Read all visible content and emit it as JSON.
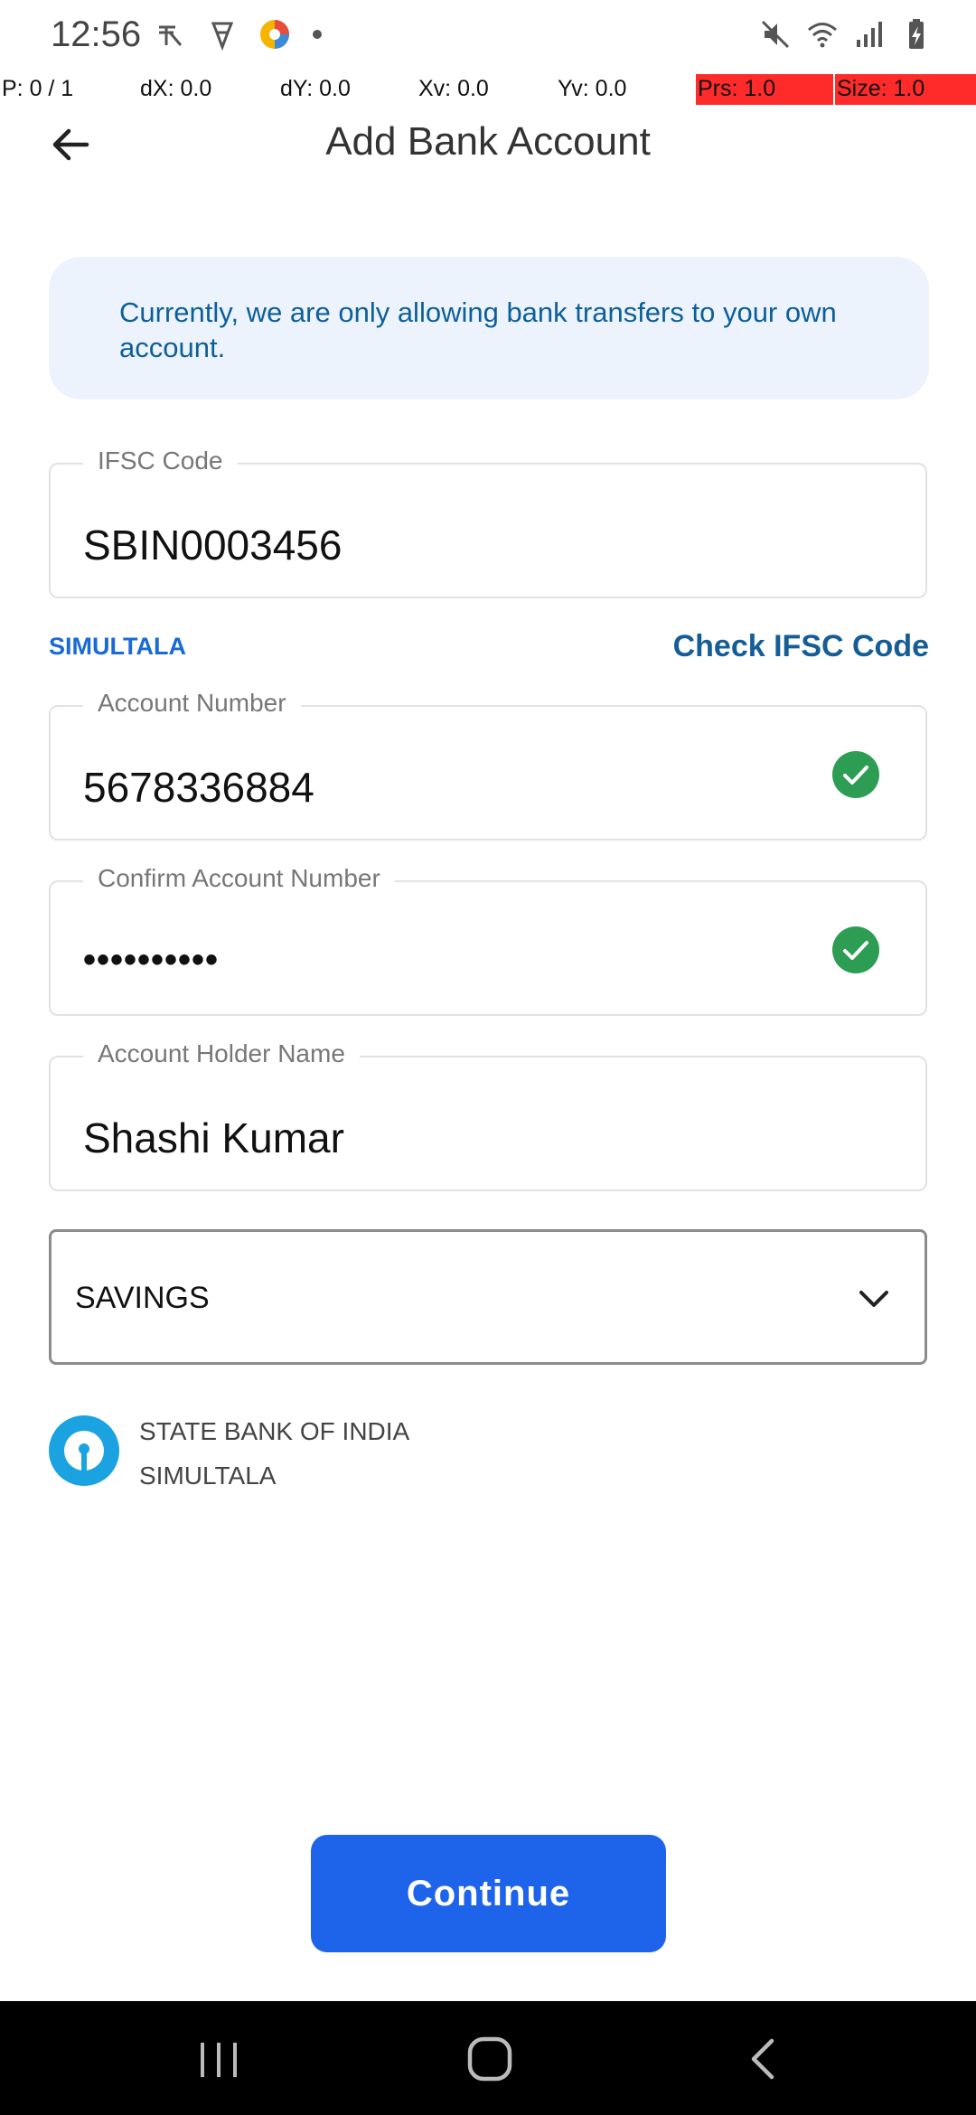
{
  "status_bar": {
    "time": "12:56",
    "left_icons": [
      "r-app-icon",
      "app-notification-icon",
      "colorful-app-icon",
      "dot-icon"
    ],
    "right_icons": [
      "mute-icon",
      "wifi-icon",
      "signal-icon",
      "battery-charging-icon"
    ]
  },
  "debug": {
    "p": "P: 0 / 1",
    "dx": "dX: 0.0",
    "dy": "dY: 0.0",
    "xv": "Xv: 0.0",
    "yv": "Yv: 0.0",
    "prs": "Prs: 1.0",
    "size": "Size: 1.0"
  },
  "header": {
    "title": "Add Bank Account",
    "back_icon": "arrow-left-icon"
  },
  "info_banner": {
    "text": "Currently, we are only allowing bank transfers to your own account."
  },
  "ifsc": {
    "label": "IFSC Code",
    "value": "SBIN0003456",
    "branch": "SIMULTALA",
    "check_link": "Check IFSC Code"
  },
  "account_number": {
    "label": "Account Number",
    "value": "5678336884",
    "verified": true
  },
  "confirm_account": {
    "label": "Confirm Account Number",
    "value": "••••••••••",
    "verified": true
  },
  "holder_name": {
    "label": "Account Holder Name",
    "value": "Shashi Kumar"
  },
  "account_type": {
    "selected": "SAVINGS"
  },
  "bank": {
    "name": "STATE BANK OF INDIA",
    "branch": "SIMULTALA"
  },
  "continue_label": "Continue",
  "colors": {
    "primary": "#1d64ea",
    "link": "#155d96",
    "success": "#2e9d54",
    "banner_bg": "#edf3fd",
    "sbi_blue": "#1aa3e0"
  }
}
